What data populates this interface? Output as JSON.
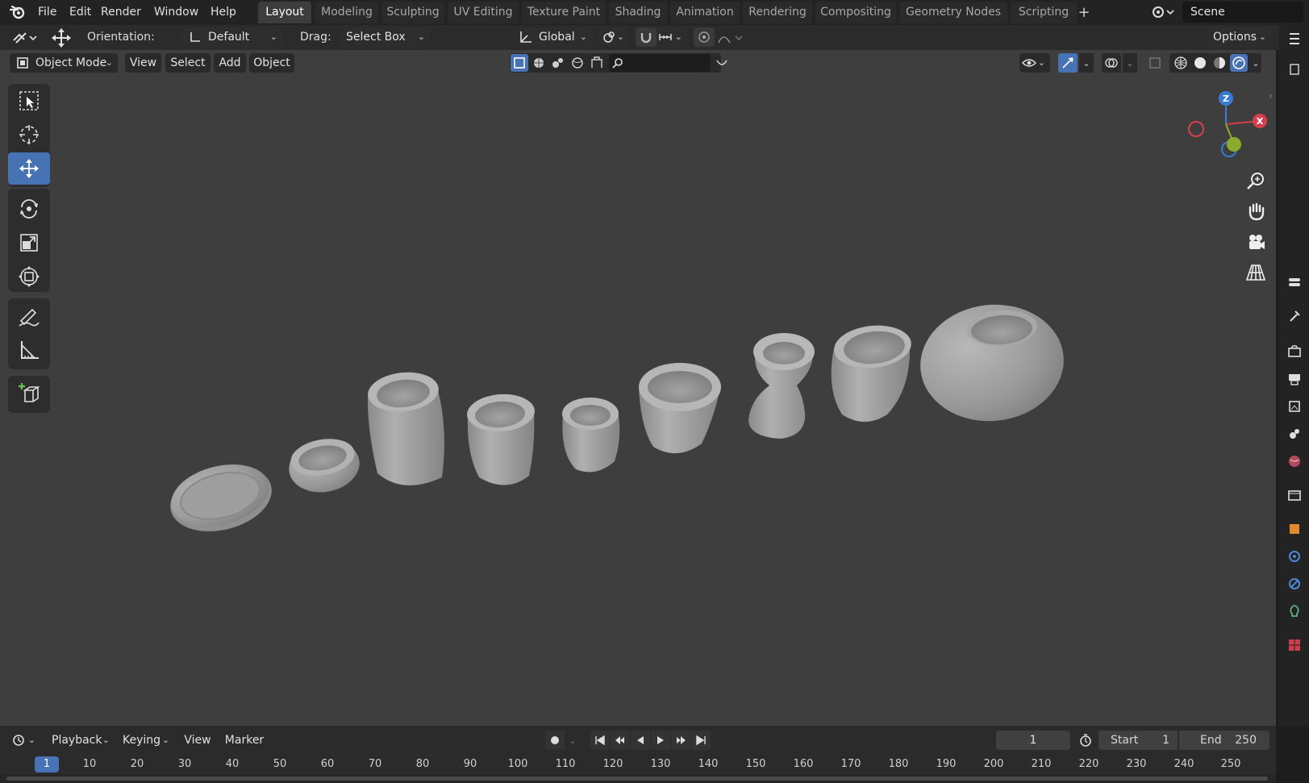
{
  "menu": {
    "file": "File",
    "edit": "Edit",
    "render": "Render",
    "window": "Window",
    "help": "Help"
  },
  "workspaces": [
    {
      "label": "Layout",
      "active": true
    },
    {
      "label": "Modeling",
      "active": false
    },
    {
      "label": "Sculpting",
      "active": false
    },
    {
      "label": "UV Editing",
      "active": false
    },
    {
      "label": "Texture Paint",
      "active": false
    },
    {
      "label": "Shading",
      "active": false
    },
    {
      "label": "Animation",
      "active": false
    },
    {
      "label": "Rendering",
      "active": false
    },
    {
      "label": "Compositing",
      "active": false
    },
    {
      "label": "Geometry Nodes",
      "active": false
    },
    {
      "label": "Scripting",
      "active": false
    }
  ],
  "add_workspace": "+",
  "scene": {
    "name": "Scene"
  },
  "tool_header": {
    "orientation_label": "Orientation:",
    "orientation_value": "Default",
    "drag_label": "Drag:",
    "drag_value": "Select Box",
    "transform_orientation": "Global",
    "options": "Options"
  },
  "viewport_header": {
    "mode": "Object Mode",
    "view": "View",
    "select": "Select",
    "add": "Add",
    "object": "Object"
  },
  "gizmo": {
    "z": "Z",
    "x": "X",
    "colors": {
      "x": "#d6404e",
      "y": "#8aab2c",
      "z": "#3a7cd4"
    }
  },
  "objects": [
    "plate",
    "shallow-bowl",
    "tall-cup",
    "cup",
    "small-cup",
    "flared-bowl",
    "vase",
    "egg-vase",
    "round-pot"
  ],
  "timeline": {
    "playback": "Playback",
    "keying": "Keying",
    "view": "View",
    "marker": "Marker",
    "current_frame": "1",
    "start_label": "Start",
    "start": "1",
    "end_label": "End",
    "end": "250",
    "ticks": [
      "1",
      "10",
      "20",
      "30",
      "40",
      "50",
      "60",
      "70",
      "80",
      "90",
      "100",
      "110",
      "120",
      "130",
      "140",
      "150",
      "160",
      "170",
      "180",
      "190",
      "200",
      "210",
      "220",
      "230",
      "240",
      "250"
    ]
  },
  "colors": {
    "accent": "#4772b3",
    "viewport": "#3e3e3e",
    "topbar": "#232323"
  }
}
